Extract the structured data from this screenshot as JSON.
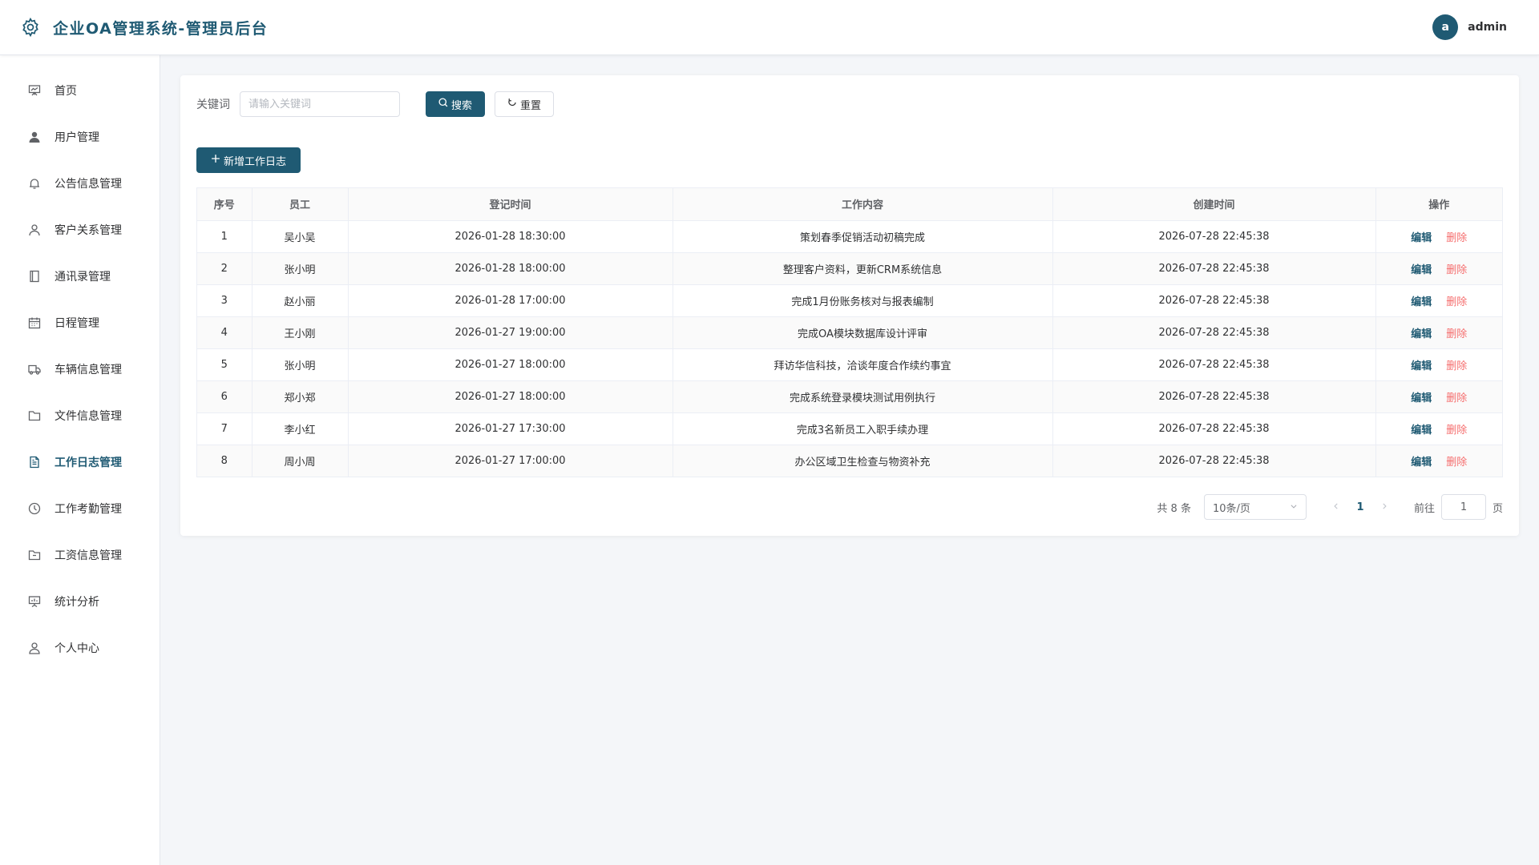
{
  "header": {
    "title": "企业OA管理系统-管理员后台",
    "user_initial": "a",
    "user_name": "admin",
    "brand_color": "#1f5a73"
  },
  "sidebar": {
    "items": [
      {
        "label": "首页",
        "icon": "presentation-icon"
      },
      {
        "label": "用户管理",
        "icon": "user-filled-icon"
      },
      {
        "label": "公告信息管理",
        "icon": "bell-icon"
      },
      {
        "label": "客户关系管理",
        "icon": "user-outline-icon"
      },
      {
        "label": "通讯录管理",
        "icon": "notebook-icon"
      },
      {
        "label": "日程管理",
        "icon": "calendar-icon"
      },
      {
        "label": "车辆信息管理",
        "icon": "truck-icon"
      },
      {
        "label": "文件信息管理",
        "icon": "folder-icon"
      },
      {
        "label": "工作日志管理",
        "icon": "document-icon",
        "active": true
      },
      {
        "label": "工作考勤管理",
        "icon": "clock-icon"
      },
      {
        "label": "工资信息管理",
        "icon": "folder-opened-icon"
      },
      {
        "label": "统计分析",
        "icon": "chart-board-icon"
      },
      {
        "label": "个人中心",
        "icon": "user-profile-icon"
      }
    ]
  },
  "search": {
    "label": "关键词",
    "placeholder": "请输入关键词",
    "value": "",
    "search_button": "搜索",
    "reset_button": "重置"
  },
  "toolbar": {
    "add_button": "新增工作日志"
  },
  "table": {
    "columns": [
      "序号",
      "员工",
      "登记时间",
      "工作内容",
      "创建时间",
      "操作"
    ],
    "edit_label": "编辑",
    "delete_label": "删除",
    "rows": [
      {
        "index": "1",
        "employee": "吴小吴",
        "register_time": "2026-01-28 18:30:00",
        "content": "策划春季促销活动初稿完成",
        "created": "2026-07-28 22:45:38"
      },
      {
        "index": "2",
        "employee": "张小明",
        "register_time": "2026-01-28 18:00:00",
        "content": "整理客户资料，更新CRM系统信息",
        "created": "2026-07-28 22:45:38"
      },
      {
        "index": "3",
        "employee": "赵小丽",
        "register_time": "2026-01-28 17:00:00",
        "content": "完成1月份账务核对与报表编制",
        "created": "2026-07-28 22:45:38"
      },
      {
        "index": "4",
        "employee": "王小刚",
        "register_time": "2026-01-27 19:00:00",
        "content": "完成OA模块数据库设计评审",
        "created": "2026-07-28 22:45:38"
      },
      {
        "index": "5",
        "employee": "张小明",
        "register_time": "2026-01-27 18:00:00",
        "content": "拜访华信科技，洽谈年度合作续约事宜",
        "created": "2026-07-28 22:45:38"
      },
      {
        "index": "6",
        "employee": "郑小郑",
        "register_time": "2026-01-27 18:00:00",
        "content": "完成系统登录模块测试用例执行",
        "created": "2026-07-28 22:45:38"
      },
      {
        "index": "7",
        "employee": "李小红",
        "register_time": "2026-01-27 17:30:00",
        "content": "完成3名新员工入职手续办理",
        "created": "2026-07-28 22:45:38"
      },
      {
        "index": "8",
        "employee": "周小周",
        "register_time": "2026-01-27 17:00:00",
        "content": "办公区域卫生检查与物资补充",
        "created": "2026-07-28 22:45:38"
      }
    ]
  },
  "pagination": {
    "total_text": "共 8 条",
    "page_size": "10条/页",
    "current_page": "1",
    "goto_label": "前往",
    "goto_value": "1",
    "page_unit": "页"
  }
}
